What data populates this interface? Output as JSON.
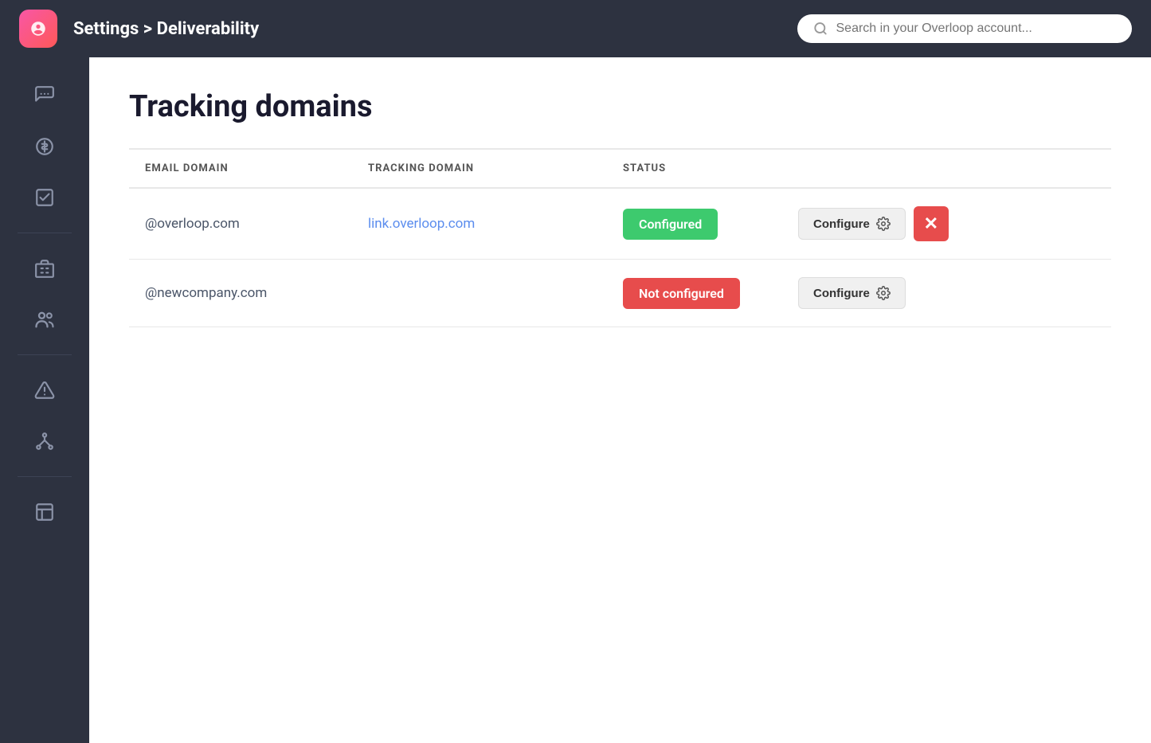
{
  "topbar": {
    "breadcrumb": "Settings > ",
    "breadcrumb_bold": "Deliverability",
    "search_placeholder": "Search in your Overloop account..."
  },
  "sidebar": {
    "items": [
      {
        "id": "conversations",
        "icon": "💬"
      },
      {
        "id": "revenue",
        "icon": "💲"
      },
      {
        "id": "tasks",
        "icon": "☑"
      },
      {
        "id": "company",
        "icon": "🏢"
      },
      {
        "id": "contacts",
        "icon": "👥"
      },
      {
        "id": "campaigns",
        "icon": "🔔"
      },
      {
        "id": "integrations",
        "icon": "⎇"
      },
      {
        "id": "analytics",
        "icon": "📊"
      }
    ]
  },
  "page": {
    "title": "Tracking domains"
  },
  "table": {
    "columns": [
      "EMAIL DOMAIN",
      "TRACKING DOMAIN",
      "STATUS"
    ],
    "rows": [
      {
        "email_domain": "@overloop.com",
        "tracking_domain": "link.overloop.com",
        "status": "Configured",
        "status_type": "configured",
        "has_delete": true
      },
      {
        "email_domain": "@newcompany.com",
        "tracking_domain": "",
        "status": "Not configured",
        "status_type": "not_configured",
        "has_delete": false
      }
    ],
    "configure_label": "Configure",
    "delete_label": "×"
  }
}
